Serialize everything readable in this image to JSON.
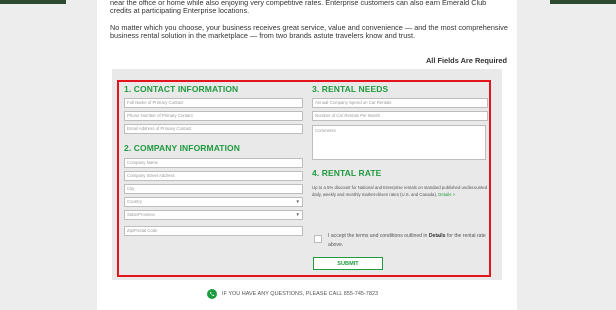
{
  "intro": {
    "line_top": "near the office or home while also enjoying very competitive rates. Enterprise customers can also earn Emerald Club credits at participating Enterprise locations.",
    "paragraph": "No matter which you choose, your business receives great service, value and convenience — and the most comprehensive business rental solution in the marketplace — from two brands astute travelers know and trust."
  },
  "required_label": "All Fields Are Required",
  "contact": {
    "heading": "1. CONTACT INFORMATION",
    "full_name_placeholder": "Full Name of Primary Contact",
    "phone_placeholder": "Phone Number of Primary Contact",
    "email_placeholder": "Email Address of Primary Contact"
  },
  "company": {
    "heading": "2. COMPANY INFORMATION",
    "name_placeholder": "Company Name",
    "street_placeholder": "Company Street Address",
    "city_placeholder": "City",
    "country_value": "Country",
    "state_value": "State/Province",
    "zip_placeholder": "Zip/Postal Code"
  },
  "rental_needs": {
    "heading": "3. RENTAL NEEDS",
    "spend_placeholder": "Annual Company Spend on Car Rentals",
    "number_placeholder": "Number of Car Rentals Per Month",
    "comments_placeholder": "Comments"
  },
  "rental_rate": {
    "heading": "4. RENTAL RATE",
    "description": "Up to a 5% discount for National and Enterprise rentals on standard published undiscounted daily, weekly and monthly market-driven rates (U.S. and Canada).",
    "details_link": "Details >"
  },
  "terms": {
    "text_before": "I accept the terms and conditions outlined in",
    "details_word": "Details",
    "text_after": "for the rental rate above."
  },
  "submit_label": "SUBMIT",
  "footer": {
    "text": "IF YOU HAVE ANY QUESTIONS, PLEASE CALL 855-745-7823"
  },
  "colors": {
    "accent_green": "#1f9b3f",
    "border_red": "#e4141e"
  },
  "icons": {
    "phone": "phone-icon",
    "select_arrow": "chevron-down-icon"
  }
}
